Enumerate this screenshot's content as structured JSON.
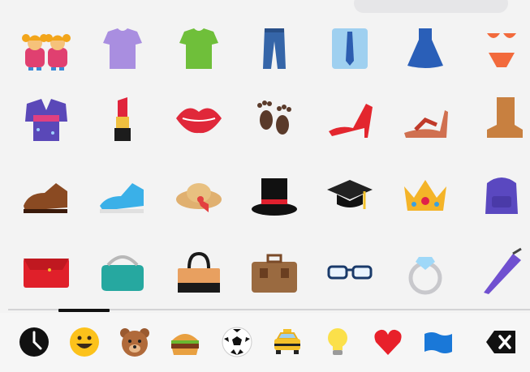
{
  "keyboard": {
    "mode": "emoji",
    "active_category": "recent",
    "grid_emoji": [
      [
        "two-girls",
        "tshirt-purple",
        "tshirt-green",
        "jeans",
        "dress-shirt",
        "dress",
        "bikini"
      ],
      [
        "kimono",
        "lipstick",
        "kiss-lips",
        "footprints",
        "high-heel",
        "sandal",
        "boot"
      ],
      [
        "mans-shoe",
        "running-shoe",
        "sun-hat",
        "top-hat",
        "graduation-cap",
        "crown",
        "backpack"
      ],
      [
        "clutch-purse",
        "coin-purse",
        "handbag",
        "briefcase",
        "eyeglasses",
        "ring",
        "closed-umbrella"
      ]
    ],
    "categories": [
      {
        "name": "recent",
        "icon": "clock-icon"
      },
      {
        "name": "smileys",
        "icon": "grinning-face-icon"
      },
      {
        "name": "animals",
        "icon": "bear-face-icon"
      },
      {
        "name": "food",
        "icon": "hamburger-icon"
      },
      {
        "name": "activity",
        "icon": "soccer-ball-icon"
      },
      {
        "name": "travel",
        "icon": "taxi-icon"
      },
      {
        "name": "objects",
        "icon": "light-bulb-icon"
      },
      {
        "name": "symbols",
        "icon": "red-heart-icon"
      },
      {
        "name": "flags",
        "icon": "blue-flag-icon"
      }
    ],
    "delete_icon": "backspace-icon",
    "colors": {
      "background": "#f3f3f3",
      "indicator": "#111111",
      "divider": "#d3d3d5"
    }
  }
}
